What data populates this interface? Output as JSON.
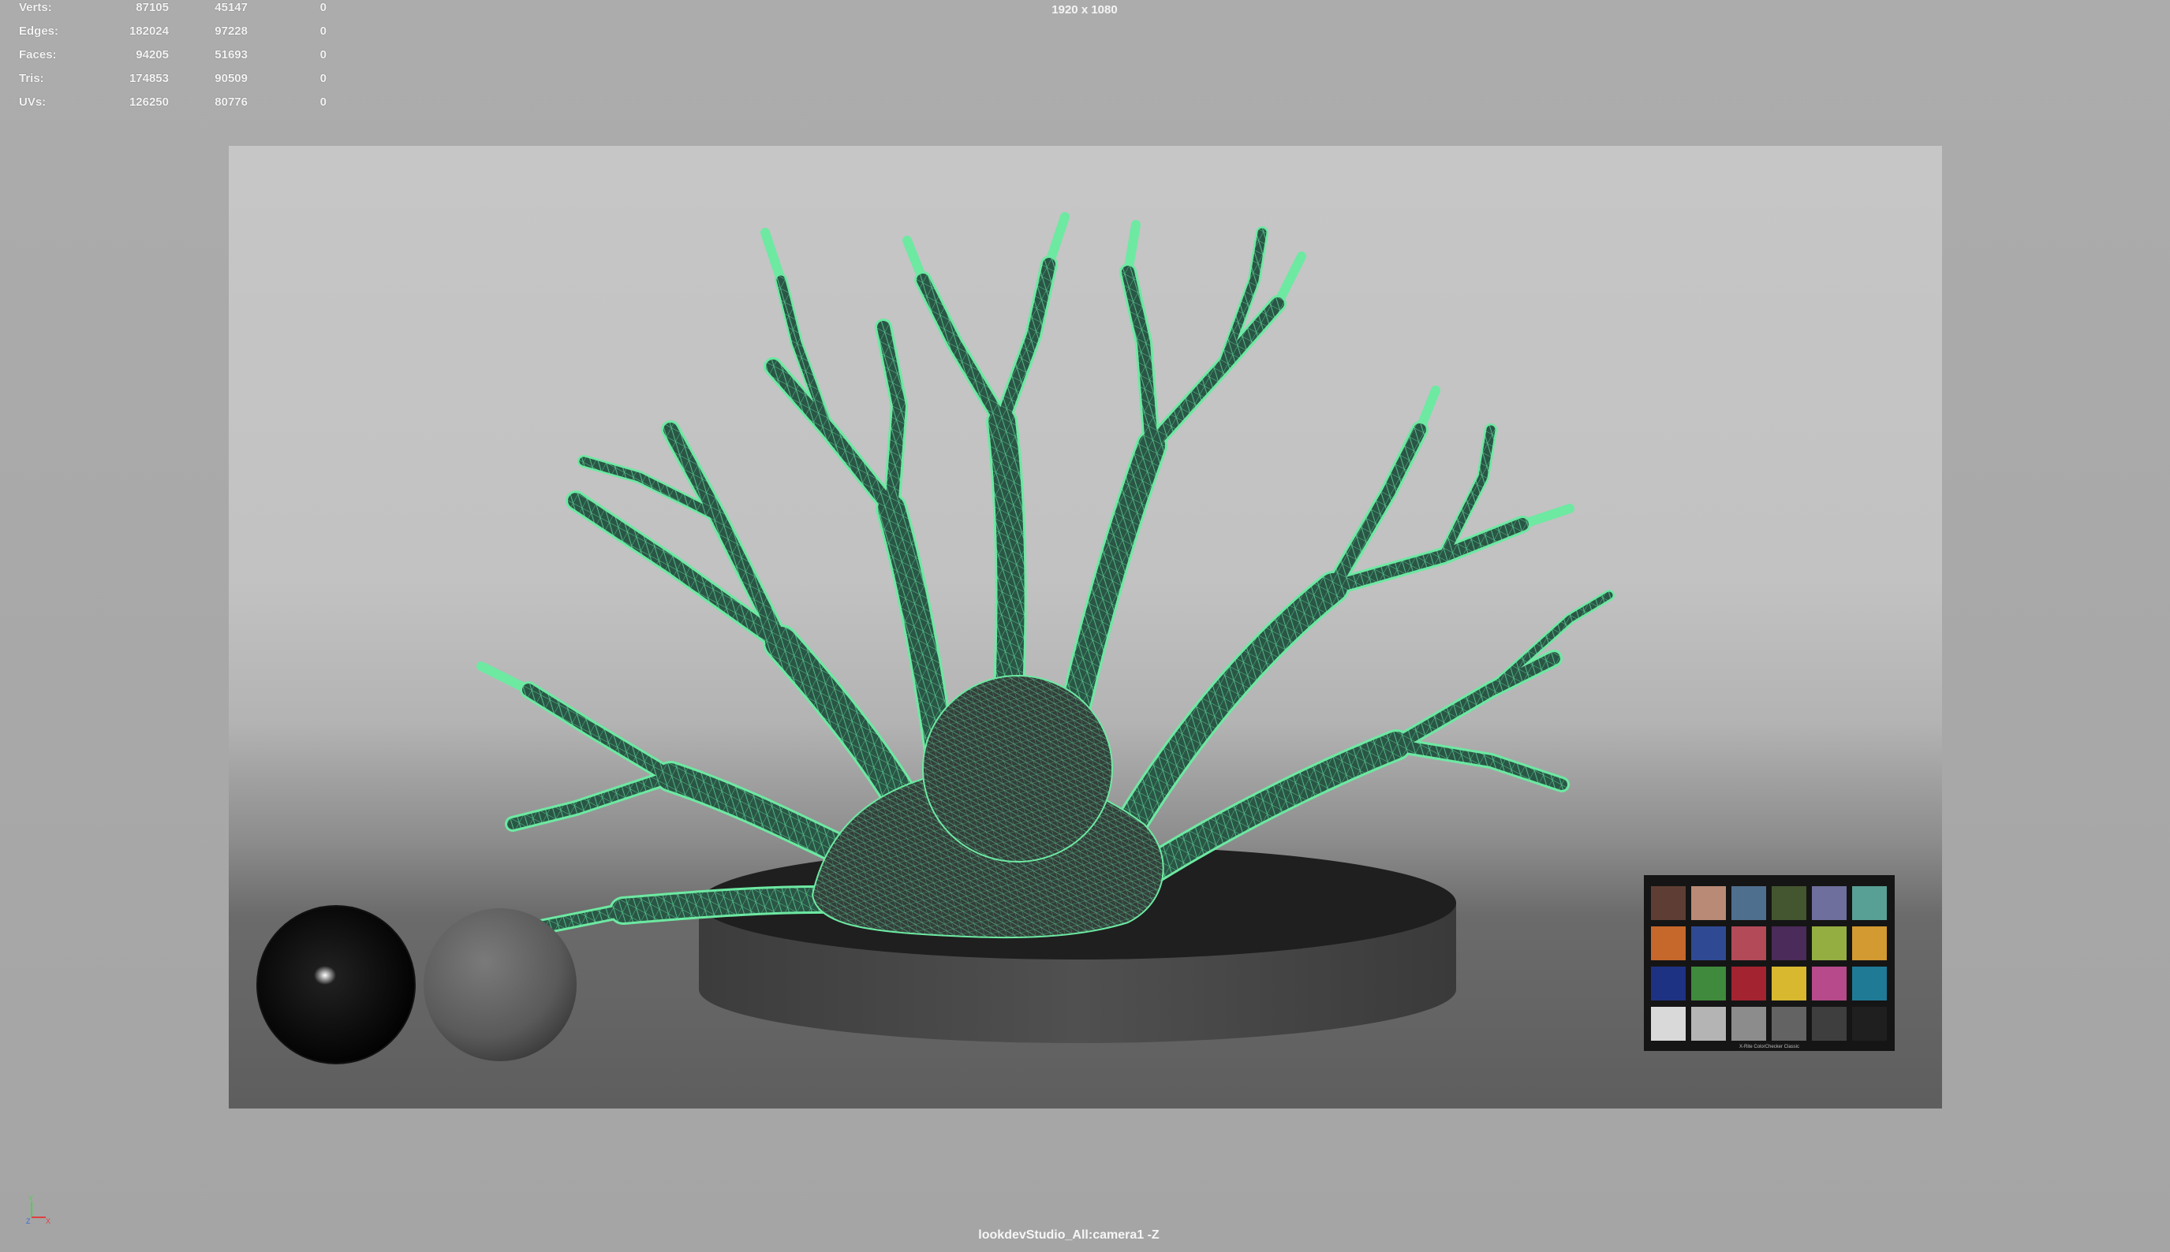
{
  "viewport": {
    "resolution": "1920 x 1080",
    "camera": "lookdevStudio_All:camera1 -Z"
  },
  "hud": {
    "rows": [
      {
        "label": "Verts:",
        "v1": "87105",
        "v2": "45147",
        "v3": "0"
      },
      {
        "label": "Edges:",
        "v1": "182024",
        "v2": "97228",
        "v3": "0"
      },
      {
        "label": "Faces:",
        "v1": "94205",
        "v2": "51693",
        "v3": "0"
      },
      {
        "label": "Tris:",
        "v1": "174853",
        "v2": "90509",
        "v3": "0"
      },
      {
        "label": "UVs:",
        "v1": "126250",
        "v2": "80776",
        "v3": "0"
      }
    ]
  },
  "color_checker": {
    "caption": "X-Rite ColorChecker Classic",
    "swatches": [
      "#5e3e34",
      "#b98a76",
      "#4f6f8e",
      "#43562f",
      "#6f6f9d",
      "#58a095",
      "#c6682b",
      "#2f4a93",
      "#b24a58",
      "#4a2b5a",
      "#94ae42",
      "#d29a30",
      "#1e3283",
      "#3f8a3c",
      "#a42330",
      "#d7b82f",
      "#b64a8a",
      "#1f7a96",
      "#d9d9d9",
      "#b4b4b4",
      "#8c8c8c",
      "#636363",
      "#3e3e3e",
      "#1f1f1f"
    ]
  },
  "axis": {
    "x": "X",
    "y": "Y",
    "z": "Z"
  },
  "colors": {
    "wireframe": "#6df0a6",
    "coral": "#2c5b4a",
    "gate_background": "#c4c4c4"
  }
}
